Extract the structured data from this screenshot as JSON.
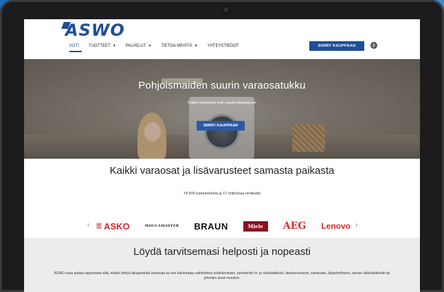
{
  "header": {
    "logo": "ASWO",
    "nav": [
      {
        "label": "KOTI",
        "has_dropdown": false,
        "active": true
      },
      {
        "label": "TUOTTEET",
        "has_dropdown": true
      },
      {
        "label": "PALVELUT",
        "has_dropdown": true
      },
      {
        "label": "TIETOA MEISTÄ",
        "has_dropdown": true
      },
      {
        "label": "YHTEYSTIEDOT",
        "has_dropdown": false
      }
    ],
    "shop_button": "SIIRRY KAUPPAAN",
    "language_icon": "globe-icon"
  },
  "hero": {
    "title": "Pohjoismaiden suurin varaosatukku",
    "subtitle": "Paljon enemmän kuin osaat odottaakaan",
    "button": "SIIRRY KAUPPAAN"
  },
  "section_brands": {
    "title": "Kaikki varaosat ja lisävarusteet samasta paikasta",
    "subtitle": "Yli 400 tuotemerkkiä ja 17 miljoonaa nimikettä",
    "prev_arrow": "‹",
    "next_arrow": "›",
    "brands": [
      "ASKO",
      "MOCCAMASTER",
      "BRAUN",
      "Miele",
      "AEG",
      "Lenovo"
    ]
  },
  "section_find": {
    "title": "Löydä tarvitsemasi helposti ja nopeasti",
    "body": "ASWO osaa auttaa riippumatta siitä, etsitkö tiettyä alkuperäistä varaosaa tai sen halvempaa vaihtoehtoa kodinkoneisiin, perinteisiin tv- ja radiolaitteisiin, tietokoneeseen, kameraan, älypuhelimeen, pieniin sähkölaitteisiin tai johonkin aivan muuhun."
  },
  "colors": {
    "brand_blue": "#1f4f96",
    "background": "#0d4f8f"
  }
}
